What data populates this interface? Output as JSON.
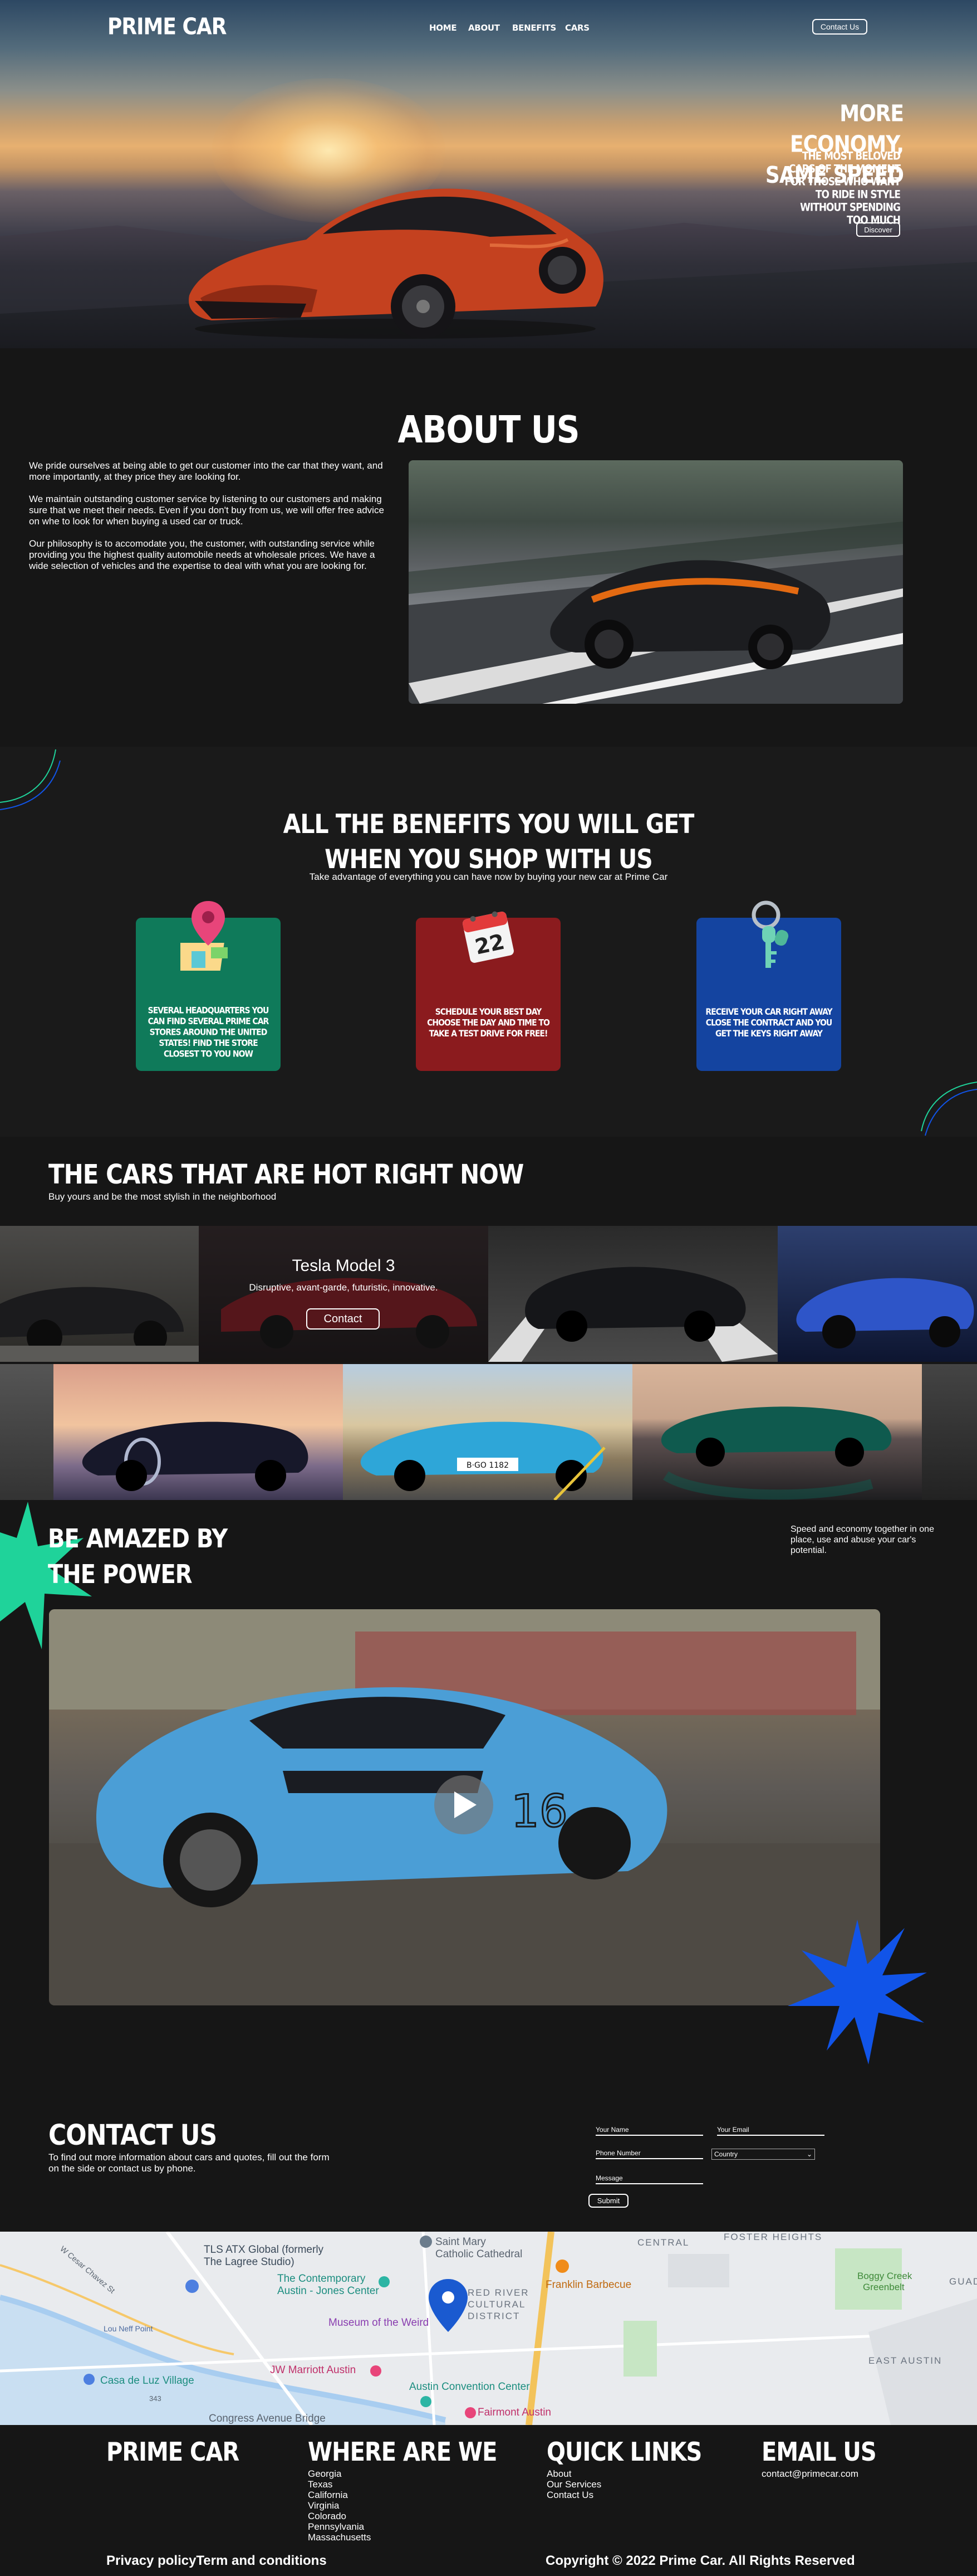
{
  "nav": {
    "logo": "PRIME CAR",
    "links": [
      "HOME",
      "ABOUT",
      "BENEFITS",
      "CARS"
    ],
    "contact_button": "Contact Us"
  },
  "hero": {
    "title_line1": "MORE ECONOMY,",
    "title_line2": "SAME SPEED",
    "subtitle": "THE MOST BELOVED CARS OF THE MOMENT FOR THOSE WHO WANT TO RIDE IN STYLE WITHOUT SPENDING TOO MUCH",
    "button": "Discover"
  },
  "about": {
    "title": "ABOUT US",
    "paragraphs": [
      "We pride ourselves at being able to get our customer into the car that they want, and more importantly, at they price they are looking for.",
      "We maintain outstanding customer service by listening to our customers and making sure that we meet their needs. Even if you don't buy from us, we will offer free advice on whe to look for when buying a used car or truck.",
      "Our philosophy is to accomodate you, the customer, with outstanding service while providing you the highest quality automobile needs at wholesale prices. We have a wide selection of vehicles and the expertise to deal with what you are looking for."
    ]
  },
  "benefits": {
    "title_line1": "ALL THE BENEFITS YOU WILL GET",
    "title_line2": "WHEN YOU SHOP WITH US",
    "subtitle": "Take advantage of everything you can have now by buying your new car at Prime Car",
    "cards": [
      {
        "text": "SEVERAL HEADQUARTERS YOU CAN FIND SEVERAL PRIME CAR STORES AROUND THE UNITED STATES! FIND THE STORE CLOSEST TO YOU NOW",
        "color": "#0f7a5a",
        "icon": "map-pin-icon"
      },
      {
        "text": "SCHEDULE YOUR BEST DAY CHOOSE THE DAY AND TIME TO TAKE A TEST DRIVE FOR FREE!",
        "color": "#8b1b1e",
        "icon": "calendar-icon",
        "calendar_day": "22"
      },
      {
        "text": "RECEIVE YOUR CAR RIGHT AWAY CLOSE THE CONTRACT AND YOU GET THE KEYS RIGHT AWAY",
        "color": "#1444a0",
        "icon": "keys-icon"
      }
    ]
  },
  "cars": {
    "title": "THE CARS THAT ARE HOT RIGHT NOW",
    "subtitle": "Buy yours and be the most stylish in the neighborhood",
    "featured": {
      "name": "Tesla Model 3",
      "description": "Disruptive, avant-garde, futuristic, innovative.",
      "button": "Contact"
    },
    "plate": "B·GO 1182"
  },
  "power": {
    "title_line1": "BE AMAZED BY",
    "title_line2": "THE POWER",
    "subtitle": "Speed and economy together in one place, use and abuse your car's potential.",
    "car_number": "16"
  },
  "contact": {
    "title": "CONTACT US",
    "text": "To find out more information about cars and quotes, fill out the form on the side or contact us by phone.",
    "fields": {
      "name": "Your Name",
      "email": "Your Email",
      "phone": "Phone Number",
      "country": "Country",
      "message": "Message"
    },
    "submit": "Submit"
  },
  "map": {
    "labels": [
      "TLS ATX Global (formerly",
      "The Lagree Studio)",
      "Saint Mary",
      "Catholic Cathedral",
      "CENTRAL",
      "FOSTER HEIGHTS",
      "The Contemporary",
      "Austin - Jones Center",
      "RED RIVER",
      "CULTURAL",
      "DISTRICT",
      "Franklin Barbecue",
      "Boggy Creek",
      "Greenbelt",
      "GUADA",
      "Museum of the Weird",
      "Lou Neff Point",
      "Casa de Luz Village",
      "JW Marriott Austin",
      "Austin Convention Center",
      "Fairmont Austin",
      "EAST AUSTIN",
      "Congress Avenue Bridge",
      "W Cesar Chavez St",
      "343"
    ]
  },
  "footer": {
    "logo": "PRIME CAR",
    "where_title": "WHERE ARE WE",
    "where_items": [
      "Georgia",
      "Texas",
      "California",
      "Virginia",
      "Colorado",
      "Pennsylvania",
      "Massachusetts"
    ],
    "quick_title": "QUICK LINKS",
    "quick_items": [
      "About",
      "Our Services",
      "Contact Us"
    ],
    "email_title": "EMAIL US",
    "email": "contact@primecar.com",
    "bottom_left": "Privacy policyTerm and conditions",
    "bottom_right": "Copyright © 2022 Prime Car. All Rights Reserved"
  },
  "colors": {
    "background": "#161616",
    "green_card": "#0f7a5a",
    "red_card": "#8b1b1e",
    "blue_card": "#1444a0",
    "accent_green": "#1fd39a",
    "accent_blue": "#1154e8"
  }
}
